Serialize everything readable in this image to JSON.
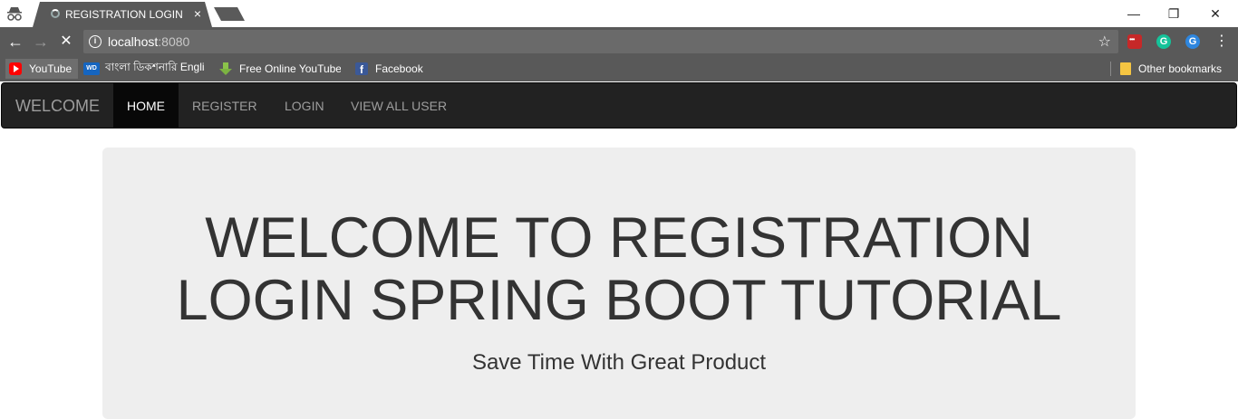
{
  "browser": {
    "tab_title": "REGISTRATION LOGIN SPRING BOOT TUTORIAL",
    "tab_close": "×",
    "url_host": "localhost",
    "url_port": ":8080",
    "window_controls": {
      "minimize": "—",
      "maximize": "❐",
      "close": "✕"
    },
    "bookmarks": [
      {
        "label": "YouTube",
        "icon": "youtube-icon"
      },
      {
        "label": "বাংলা ডিকশনারি English",
        "icon": "wd-icon"
      },
      {
        "label": "Free Online YouTube Downloader",
        "icon": "download-arrow-icon"
      },
      {
        "label": "Facebook",
        "icon": "facebook-icon"
      }
    ],
    "other_bookmarks": "Other bookmarks"
  },
  "navbar": {
    "brand": "WELCOME",
    "items": [
      {
        "label": "HOME",
        "active": true
      },
      {
        "label": "REGISTER",
        "active": false
      },
      {
        "label": "LOGIN",
        "active": false
      },
      {
        "label": "VIEW ALL USER",
        "active": false
      }
    ]
  },
  "hero": {
    "title_line1": "WELCOME TO REGISTRATION",
    "title_line2": "LOGIN SPRING BOOT TUTORIAL",
    "subtitle": "Save Time With Great Product"
  },
  "colors": {
    "navbar_bg": "#222222",
    "navbar_active_bg": "#080808",
    "jumbotron_bg": "#eeeeee",
    "chrome_bg": "#595959"
  }
}
